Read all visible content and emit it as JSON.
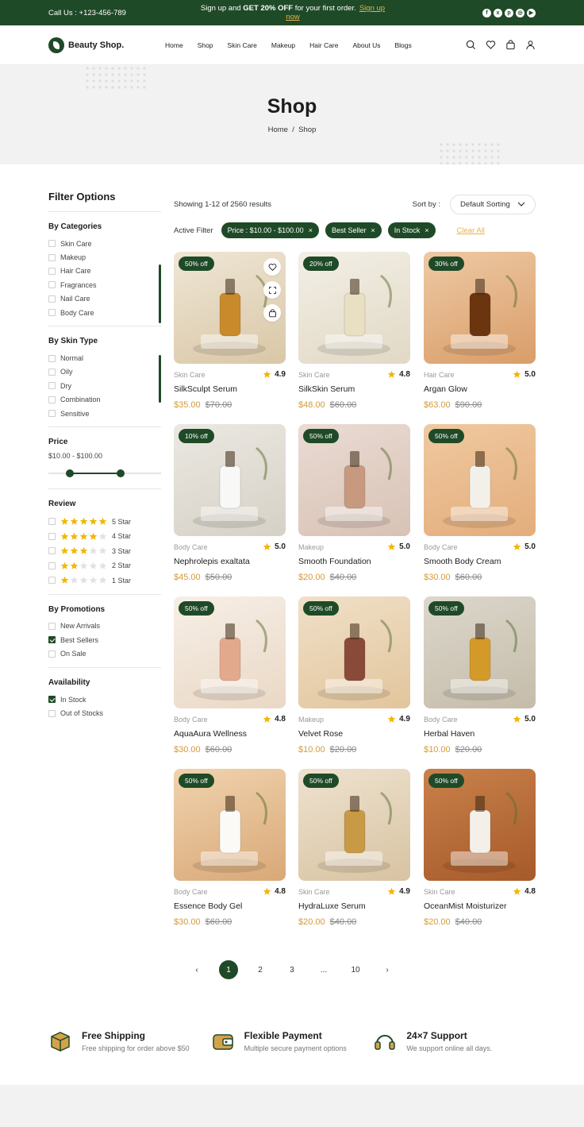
{
  "topbar": {
    "call": "Call Us : +123-456-789",
    "promo_pre": "Sign up and ",
    "promo_bold": "GET 20% OFF",
    "promo_post": " for your first order.",
    "signup": "Sign up now",
    "socials": [
      "facebook-icon",
      "x-icon",
      "pinterest-icon",
      "instagram-icon",
      "youtube-icon"
    ]
  },
  "header": {
    "brand": "Beauty Shop.",
    "nav": [
      "Home",
      "Shop",
      "Skin Care",
      "Makeup",
      "Hair Care",
      "About Us",
      "Blogs"
    ]
  },
  "hero": {
    "title": "Shop",
    "crumb_home": "Home",
    "crumb_sep": "/",
    "crumb_current": "Shop"
  },
  "filters": {
    "title": "Filter Options",
    "categories": {
      "title": "By Categories",
      "items": [
        "Skin Care",
        "Makeup",
        "Hair Care",
        "Fragrances",
        "Nail Care",
        "Body Care"
      ]
    },
    "skin_type": {
      "title": "By Skin Type",
      "items": [
        "Normal",
        "Oily",
        "Dry",
        "Combination",
        "Sensitive"
      ]
    },
    "price": {
      "title": "Price",
      "range": "$10.00 - $100.00",
      "low_fraction": 0.19,
      "high_fraction": 0.64
    },
    "review": {
      "title": "Review",
      "items": [
        {
          "label": "5 Star",
          "stars": 5
        },
        {
          "label": "4 Star",
          "stars": 4
        },
        {
          "label": "3 Star",
          "stars": 3
        },
        {
          "label": "2 Star",
          "stars": 2
        },
        {
          "label": "1 Star",
          "stars": 1
        }
      ]
    },
    "promotions": {
      "title": "By Promotions",
      "items": [
        {
          "label": "New Arrivals",
          "checked": false
        },
        {
          "label": "Best Sellers",
          "checked": true
        },
        {
          "label": "On Sale",
          "checked": false
        }
      ]
    },
    "availability": {
      "title": "Availability",
      "items": [
        {
          "label": "In Stock",
          "checked": true
        },
        {
          "label": "Out of Stocks",
          "checked": false
        }
      ]
    }
  },
  "listing": {
    "showing": "Showing 1-12 of 2560 results",
    "sort_label": "Sort by :",
    "sort_value": "Default Sorting",
    "active_label": "Active Filter",
    "chips": [
      "Price : $10.00 - $100.00",
      "Best Seller",
      "In Stock"
    ],
    "clear": "Clear All"
  },
  "products": [
    {
      "badge": "50% off",
      "category": "Skin Care",
      "rating": "4.9",
      "name": "SilkSculpt Serum",
      "price": "$35.00",
      "old": "$70.00",
      "bg": [
        "#efe6d6",
        "#d9c7a6"
      ],
      "item": "#c98a2c"
    },
    {
      "badge": "20% off",
      "category": "Skin Care",
      "rating": "4.8",
      "name": "SilkSkin Serum",
      "price": "$48.00",
      "old": "$60.00",
      "bg": [
        "#f3efe6",
        "#e1d9c5"
      ],
      "item": "#e9dfc3"
    },
    {
      "badge": "30% off",
      "category": "Hair Care",
      "rating": "5.0",
      "name": "Argan Glow",
      "price": "$63.00",
      "old": "$90.00",
      "bg": [
        "#eec9a4",
        "#d99d69"
      ],
      "item": "#6b3510"
    },
    {
      "badge": "10% off",
      "category": "Body Care",
      "rating": "5.0",
      "name": "Nephrolepis exaltata",
      "price": "$45.00",
      "old": "$50.00",
      "bg": [
        "#ebe8e2",
        "#d6d1c6"
      ],
      "item": "#f8f8f6"
    },
    {
      "badge": "50% off",
      "category": "Makeup",
      "rating": "5.0",
      "name": "Smooth Foundation",
      "price": "$20.00",
      "old": "$40.00",
      "bg": [
        "#eadbd3",
        "#d8c2b5"
      ],
      "item": "#c79a80"
    },
    {
      "badge": "50% off",
      "category": "Body Care",
      "rating": "5.0",
      "name": "Smooth Body Cream",
      "price": "$30.00",
      "old": "$60.00",
      "bg": [
        "#f0c9a0",
        "#e3ad7c"
      ],
      "item": "#f3f0ea"
    },
    {
      "badge": "50% off",
      "category": "Body Care",
      "rating": "4.8",
      "name": "AquaAura Wellness",
      "price": "$30.00",
      "old": "$60.00",
      "bg": [
        "#f6efe7",
        "#ead8c5"
      ],
      "item": "#e3a98d"
    },
    {
      "badge": "50% off",
      "category": "Makeup",
      "rating": "4.9",
      "name": "Velvet Rose",
      "price": "$10.00",
      "old": "$20.00",
      "bg": [
        "#f0e0c8",
        "#e2c59c"
      ],
      "item": "#8a4a3a"
    },
    {
      "badge": "50% off",
      "category": "Body Care",
      "rating": "5.0",
      "name": "Herbal Haven",
      "price": "$10.00",
      "old": "$20.00",
      "bg": [
        "#dcd7cc",
        "#c5bca9"
      ],
      "item": "#d39a2a"
    },
    {
      "badge": "50% off",
      "category": "Body Care",
      "rating": "4.8",
      "name": "Essence Body Gel",
      "price": "$30.00",
      "old": "$60.00",
      "bg": [
        "#f0d3ae",
        "#d9a877"
      ],
      "item": "#fbfaf6"
    },
    {
      "badge": "50% off",
      "category": "Skin Care",
      "rating": "4.9",
      "name": "HydraLuxe Serum",
      "price": "$20.00",
      "old": "$40.00",
      "bg": [
        "#eee2cf",
        "#d8c3a2"
      ],
      "item": "#c99a45"
    },
    {
      "badge": "50% off",
      "category": "Skin Care",
      "rating": "4.8",
      "name": "OceanMist Moisturizer",
      "price": "$20.00",
      "old": "$40.00",
      "bg": [
        "#c9814a",
        "#a65a2a"
      ],
      "item": "#f4efe8"
    }
  ],
  "pagination": {
    "prev": "‹",
    "pages": [
      "1",
      "2",
      "3",
      "...",
      "10"
    ],
    "current": "1",
    "next": "›"
  },
  "features": [
    {
      "icon": "box-icon",
      "title": "Free Shipping",
      "sub": "Free shipping for order above $50"
    },
    {
      "icon": "wallet-icon",
      "title": "Flexible Payment",
      "sub": "Multiple secure payment options"
    },
    {
      "icon": "headset-icon",
      "title": "24×7 Support",
      "sub": "We support online all days."
    }
  ],
  "colors": {
    "brand": "#1f4a27",
    "accent": "#d49a3a",
    "star": "#f2b705"
  }
}
